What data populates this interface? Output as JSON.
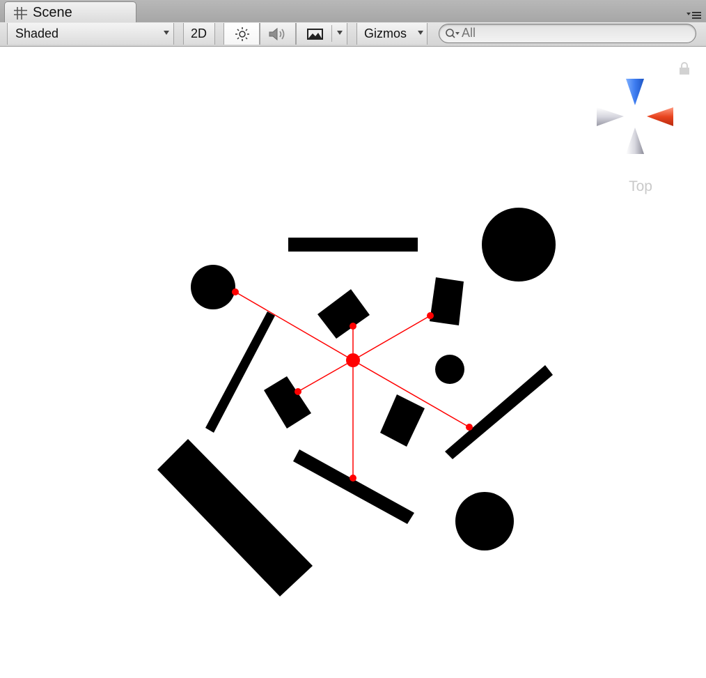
{
  "window": {
    "tab_title": "Scene",
    "tab_icon": "scene-grid-icon",
    "tab_menu_icon": "panel-menu-icon"
  },
  "toolbar": {
    "draw_mode": "Shaded",
    "mode_2d_label": "2D",
    "lighting_icon": "sun-icon",
    "audio_icon": "speaker-icon",
    "effects_icon": "image-icon",
    "gizmos_label": "Gizmos",
    "search_placeholder": "All",
    "search_icon": "search-icon"
  },
  "scene_gizmo": {
    "view_label": "Top",
    "y_axis_color": "#3d7cf0",
    "x_axis_color": "#e8441f"
  },
  "scene": {
    "background": "#ffffff",
    "object_color": "#000000",
    "joint_color": "#ff0000"
  }
}
